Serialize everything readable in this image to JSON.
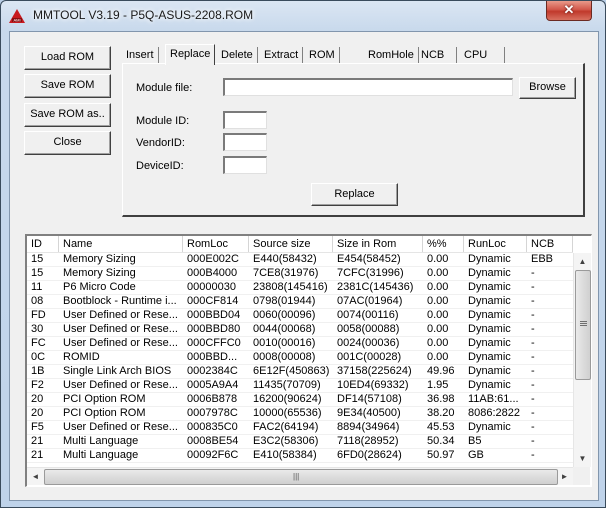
{
  "window": {
    "title": "MMTOOL V3.19 - P5Q-ASUS-2208.ROM",
    "app_icon": "mmtool-app-icon",
    "close_glyph": "✕"
  },
  "left_buttons": [
    {
      "label": "Load ROM"
    },
    {
      "label": "Save ROM"
    },
    {
      "label": "Save ROM as.."
    },
    {
      "label": "Close"
    }
  ],
  "tabs": [
    {
      "label": "Insert",
      "active": false
    },
    {
      "label": "Replace",
      "active": true
    },
    {
      "label": "Delete",
      "active": false
    },
    {
      "label": "Extract",
      "active": false
    },
    {
      "label": "ROM Info",
      "active": false
    },
    {
      "label": "RomHole",
      "active": false
    },
    {
      "label": "NCB",
      "active": false
    },
    {
      "label": "CPU PATCH",
      "active": false
    }
  ],
  "replace_panel": {
    "module_file_label": "Module file:",
    "module_file_value": "",
    "browse_label": "Browse",
    "module_id_label": "Module ID:",
    "module_id_value": "",
    "vendor_id_label": "VendorID:",
    "vendor_id_value": "",
    "device_id_label": "DeviceID:",
    "device_id_value": "",
    "replace_label": "Replace"
  },
  "table": {
    "columns": [
      "ID",
      "Name",
      "RomLoc",
      "Source size",
      "Size in Rom",
      "%%",
      "RunLoc",
      "NCB"
    ],
    "rows": [
      [
        "15",
        "Memory Sizing",
        "000E002C",
        "E440(58432)",
        "E454(58452)",
        "0.00",
        "Dynamic",
        "EBB"
      ],
      [
        "15",
        "Memory Sizing",
        "000B4000",
        "7CE8(31976)",
        "7CFC(31996)",
        "0.00",
        "Dynamic",
        "-"
      ],
      [
        "11",
        "P6 Micro Code",
        "00000030",
        "23808(145416)",
        "2381C(145436)",
        "0.00",
        "Dynamic",
        "-"
      ],
      [
        "08",
        "Bootblock - Runtime i...",
        "000CF814",
        "0798(01944)",
        "07AC(01964)",
        "0.00",
        "Dynamic",
        "-"
      ],
      [
        "FD",
        "User Defined or Rese...",
        "000BBD04",
        "0060(00096)",
        "0074(00116)",
        "0.00",
        "Dynamic",
        "-"
      ],
      [
        "30",
        "User Defined or Rese...",
        "000BBD80",
        "0044(00068)",
        "0058(00088)",
        "0.00",
        "Dynamic",
        "-"
      ],
      [
        "FC",
        "User Defined or Rese...",
        "000CFFC0",
        "0010(00016)",
        "0024(00036)",
        "0.00",
        "Dynamic",
        "-"
      ],
      [
        "0C",
        "ROMID",
        "000BBD...",
        "0008(00008)",
        "001C(00028)",
        "0.00",
        "Dynamic",
        "-"
      ],
      [
        "1B",
        "Single Link Arch BIOS",
        "0002384C",
        "6E12F(450863)",
        "37158(225624)",
        "49.96",
        "Dynamic",
        "-"
      ],
      [
        "F2",
        "User Defined or Rese...",
        "0005A9A4",
        "11435(70709)",
        "10ED4(69332)",
        "1.95",
        "Dynamic",
        "-"
      ],
      [
        "20",
        "PCI Option ROM",
        "0006B878",
        "16200(90624)",
        "DF14(57108)",
        "36.98",
        "11AB:61...",
        "-"
      ],
      [
        "20",
        "PCI Option ROM",
        "0007978C",
        "10000(65536)",
        "9E34(40500)",
        "38.20",
        "8086:2822",
        "-"
      ],
      [
        "F5",
        "User Defined or Rese...",
        "000835C0",
        "FAC2(64194)",
        "8894(34964)",
        "45.53",
        "Dynamic",
        "-"
      ],
      [
        "21",
        "Multi Language",
        "0008BE54",
        "E3C2(58306)",
        "7118(28952)",
        "50.34",
        "B5",
        "-"
      ],
      [
        "21",
        "Multi Language",
        "00092F6C",
        "E410(58384)",
        "6FD0(28624)",
        "50.97",
        "GB",
        "-"
      ]
    ],
    "vscroll": {
      "up_glyph": "▲",
      "down_glyph": "▼",
      "position_fraction": 0.0,
      "visible_fraction": 0.55
    },
    "hscroll": {
      "left_glyph": "◄",
      "right_glyph": "►",
      "grip_glyph": "|||"
    }
  }
}
